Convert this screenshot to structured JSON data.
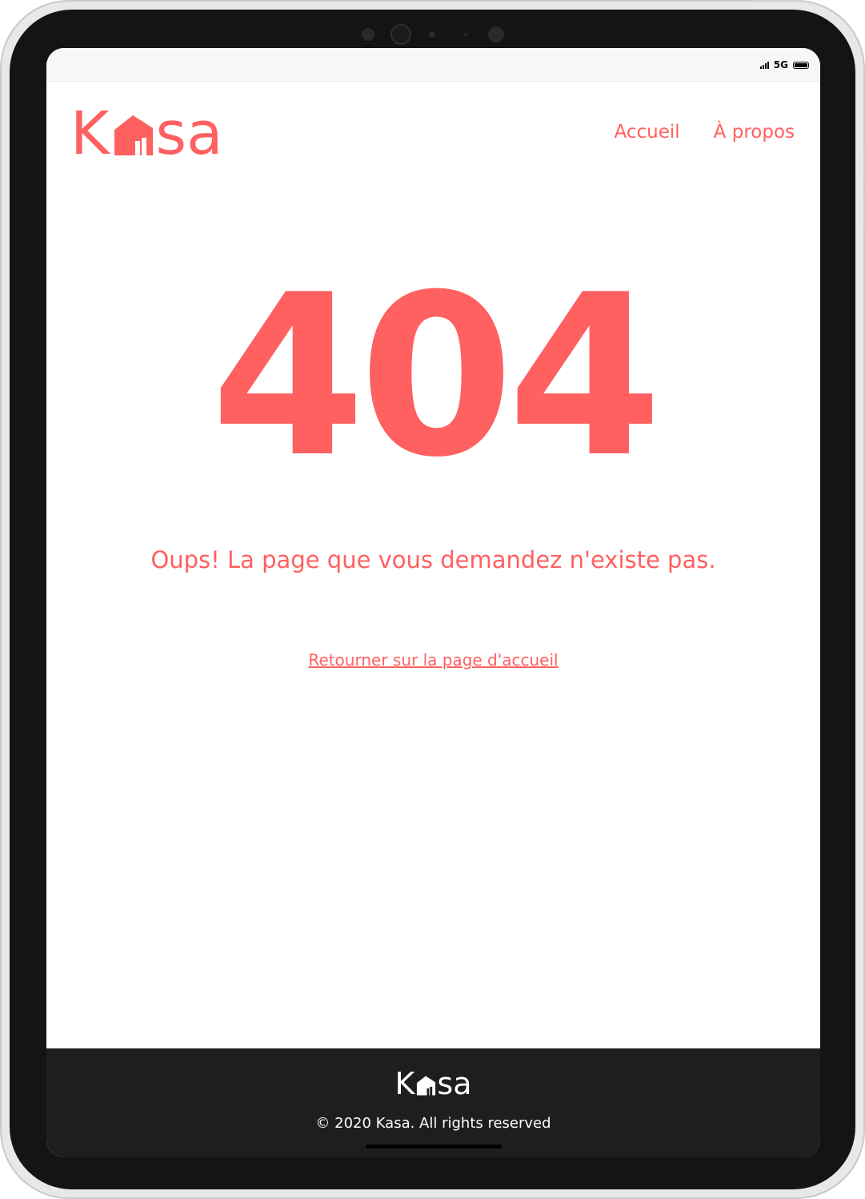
{
  "status_bar": {
    "network": "5G",
    "icons": [
      "signal-icon",
      "battery-icon"
    ]
  },
  "header": {
    "logo_text_left": "K",
    "logo_text_right": "sa",
    "nav": [
      {
        "label": "Accueil"
      },
      {
        "label": "À propos"
      }
    ]
  },
  "error": {
    "code": "404",
    "message": "Oups! La page que vous demandez n'existe pas.",
    "home_link": "Retourner sur la page d'accueil"
  },
  "footer": {
    "logo_text_left": "K",
    "logo_text_right": "sa",
    "copyright": "© 2020 Kasa. All rights reserved"
  },
  "colors": {
    "accent": "#ff6060",
    "footer_bg": "#1e1e1e",
    "footer_text": "#ffffff"
  }
}
